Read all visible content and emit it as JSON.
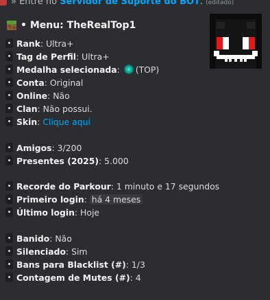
{
  "topbar": {
    "prefix": "» Entre no ",
    "server_link": "Servidor de Suporte do BOT",
    "suffix": ". ",
    "edited": "(editado)"
  },
  "embed": {
    "title": "• Menu: TheRealTop1",
    "icon": "grass-block-icon",
    "thumbnail": "minecraft-skin-head",
    "fields": [
      {
        "label": "Rank",
        "value": "Ultra+"
      },
      {
        "label": "Tag de Perfil",
        "value": "Ultra+"
      },
      {
        "label": "Medalha selecionada",
        "value": "(TOP)",
        "icon": "medal-icon"
      },
      {
        "label": "Conta",
        "value": "Original"
      },
      {
        "label": "Online",
        "value": "Não"
      },
      {
        "label": "Clan",
        "value": "Não possui."
      },
      {
        "label": "Skin",
        "value": "Clique aqui"
      },
      {
        "label": "Amigos",
        "value": "3/200"
      },
      {
        "label": "Presentes (2025)",
        "value": "5.000"
      },
      {
        "label": "Recorde do Parkour",
        "value": "1 minuto e 17 segundos"
      },
      {
        "label": "Primeiro login",
        "value": "há 4 meses"
      },
      {
        "label": "Último login",
        "value": "Hoje"
      },
      {
        "label": "Banido",
        "value": "Não"
      },
      {
        "label": "Silenciado",
        "value": "Sim"
      },
      {
        "label": "Bans para Blacklist (#)",
        "value": "1/3"
      },
      {
        "label": "Contagem de Mutes (#)",
        "value": "4"
      }
    ]
  }
}
